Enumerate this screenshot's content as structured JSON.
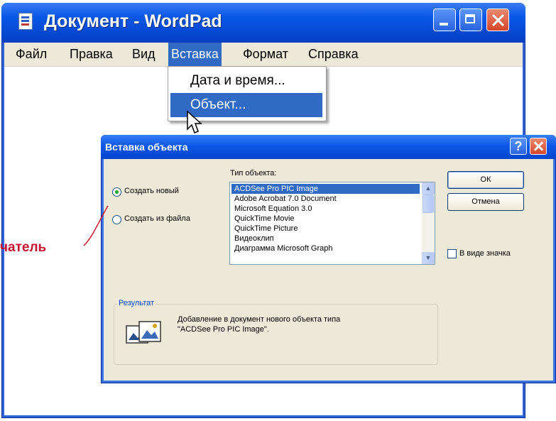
{
  "window": {
    "title": "Документ - WordPad"
  },
  "menu": {
    "items": [
      "Файл",
      "Правка",
      "Вид",
      "Вставка",
      "Формат",
      "Справка"
    ]
  },
  "insert_menu": {
    "items": [
      "Дата и время...",
      "Объект..."
    ]
  },
  "dialog": {
    "title": "Вставка объекта",
    "radio_new": "Создать новый",
    "radio_file": "Создать из файла",
    "object_type_label": "Тип объекта:",
    "object_types": [
      "ACDSee Pro PIC Image",
      "Adobe Acrobat 7.0 Document",
      "Microsoft Equation 3.0",
      "QuickTime Movie",
      "QuickTime Picture",
      "Видеоклип",
      "Диаграмма Microsoft Graph"
    ],
    "ok_label": "ОК",
    "cancel_label": "Отмена",
    "as_icon_label": "В виде значка",
    "result_label": "Результат",
    "result_text_1": "Добавление в документ нового объекта типа",
    "result_text_2": "\"ACDSee Pro PIC Image\"."
  },
  "annotation": {
    "text": "чатель",
    "color": "#c8102e"
  },
  "colors": {
    "xp_blue": "#0a58e8",
    "selection": "#316ac5",
    "dialog_face": "#ece9d8"
  }
}
